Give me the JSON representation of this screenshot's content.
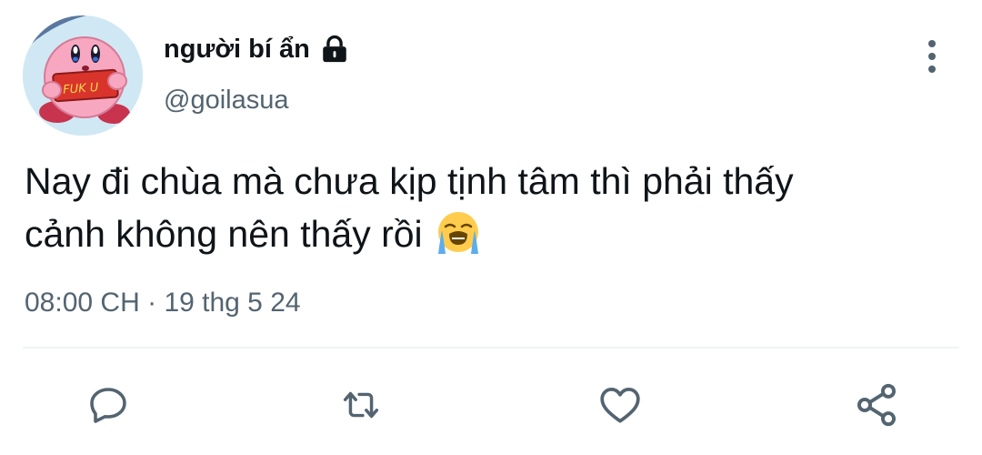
{
  "author": {
    "display_name": "người bí ẩn",
    "handle": "@goilasua",
    "avatar_caption": "FUK U"
  },
  "tweet": {
    "text": "Nay đi chùa mà chưa kịp tịnh tâm thì phải thấy\ncảnh không nên thấy rồi",
    "emoji": "loudly-crying-face",
    "time": "08:00 CH",
    "separator": "·",
    "date": "19 thg 5 24"
  },
  "icons": {
    "lock": "lock-icon",
    "more": "more-vertical-icon",
    "reply": "reply-bubble-icon",
    "retweet": "retweet-icon",
    "like": "heart-icon",
    "share": "share-icon"
  },
  "colors": {
    "text": "#0f1419",
    "secondary": "#536471",
    "divider": "#eff3f4",
    "avatar_bg": "#cfe8f4",
    "kirby_pink": "#f7a8c0"
  }
}
